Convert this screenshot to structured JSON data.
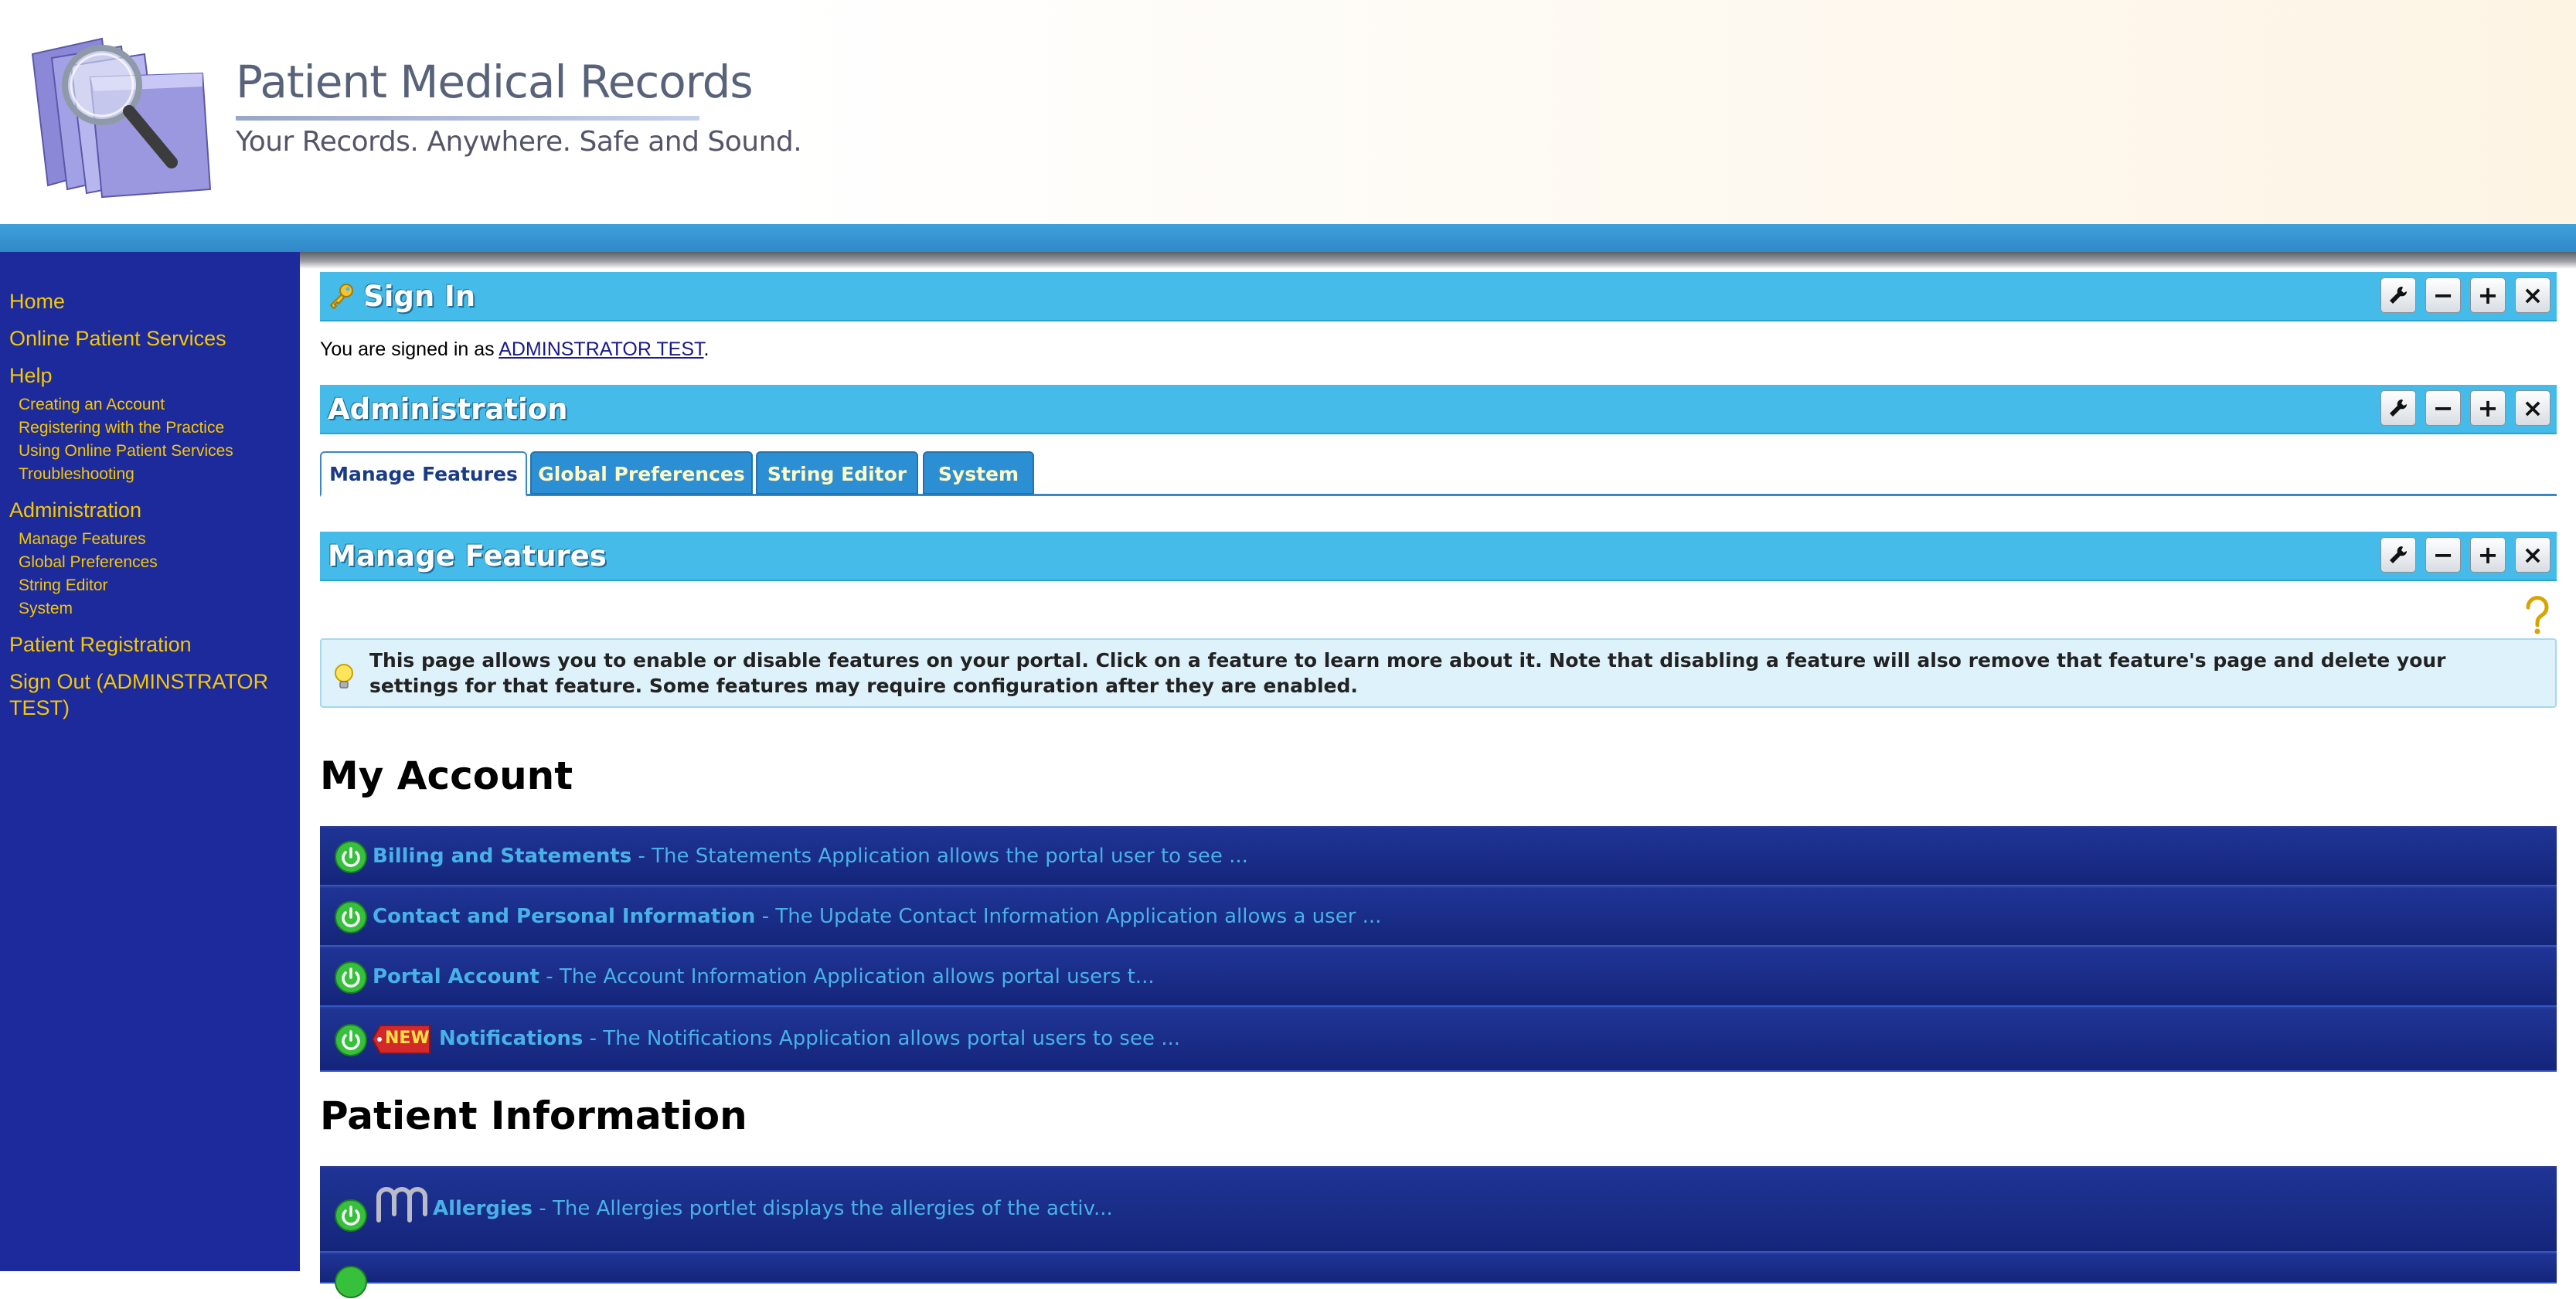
{
  "header": {
    "title": "Patient Medical Records",
    "tagline": "Your Records. Anywhere. Safe and Sound."
  },
  "sidebar": {
    "items": [
      {
        "label": "Home"
      },
      {
        "label": "Online Patient Services"
      },
      {
        "label": "Help",
        "children": [
          {
            "label": "Creating an Account"
          },
          {
            "label": "Registering with the Practice"
          },
          {
            "label": "Using Online Patient Services"
          },
          {
            "label": "Troubleshooting"
          }
        ]
      },
      {
        "label": "Administration",
        "children": [
          {
            "label": "Manage Features"
          },
          {
            "label": "Global Preferences"
          },
          {
            "label": "String Editor"
          },
          {
            "label": "System"
          }
        ]
      },
      {
        "label": "Patient Registration"
      },
      {
        "label": "Sign Out (ADMINSTRATOR TEST)"
      }
    ]
  },
  "signin": {
    "title": "Sign In",
    "text_before": "You are signed in as ",
    "user_link": "ADMINSTRATOR TEST",
    "text_after": "."
  },
  "administration": {
    "title": "Administration",
    "tabs": [
      {
        "label": "Manage Features",
        "active": true
      },
      {
        "label": "Global Preferences",
        "active": false
      },
      {
        "label": "String Editor",
        "active": false
      },
      {
        "label": "System",
        "active": false
      }
    ]
  },
  "manage_features": {
    "title": "Manage Features",
    "info": "This page allows you to enable or disable features on your portal. Click on a feature to learn more about it. Note that disabling a feature will also remove that feature's page and delete your settings for that feature. Some features may require configuration after they are enabled."
  },
  "controls": {
    "minimize": "−",
    "maximize": "+",
    "close": "×"
  },
  "sections": [
    {
      "title": "My Account",
      "features": [
        {
          "name": "Billing and Statements",
          "desc": " - The Statements Application allows the portal user to see ..."
        },
        {
          "name": "Contact and Personal Information",
          "desc": " - The Update Contact Information Application allows a user ..."
        },
        {
          "name": "Portal Account",
          "desc": " - The Account Information Application allows portal users t..."
        },
        {
          "name": "Notifications",
          "desc": " - The Notifications Application allows portal users to see ...",
          "badge": "NEW"
        }
      ]
    },
    {
      "title": "Patient Information",
      "features": [
        {
          "name": "Allergies",
          "desc": " - The Allergies portlet displays the allergies of the activ..."
        }
      ]
    }
  ],
  "colors": {
    "sidebar_bg": "#1d2a9c",
    "nav_text": "#f5c800",
    "portlet_bar": "#44bbe9",
    "feature_row": "#1f3496",
    "feature_text": "#48b2e8"
  }
}
